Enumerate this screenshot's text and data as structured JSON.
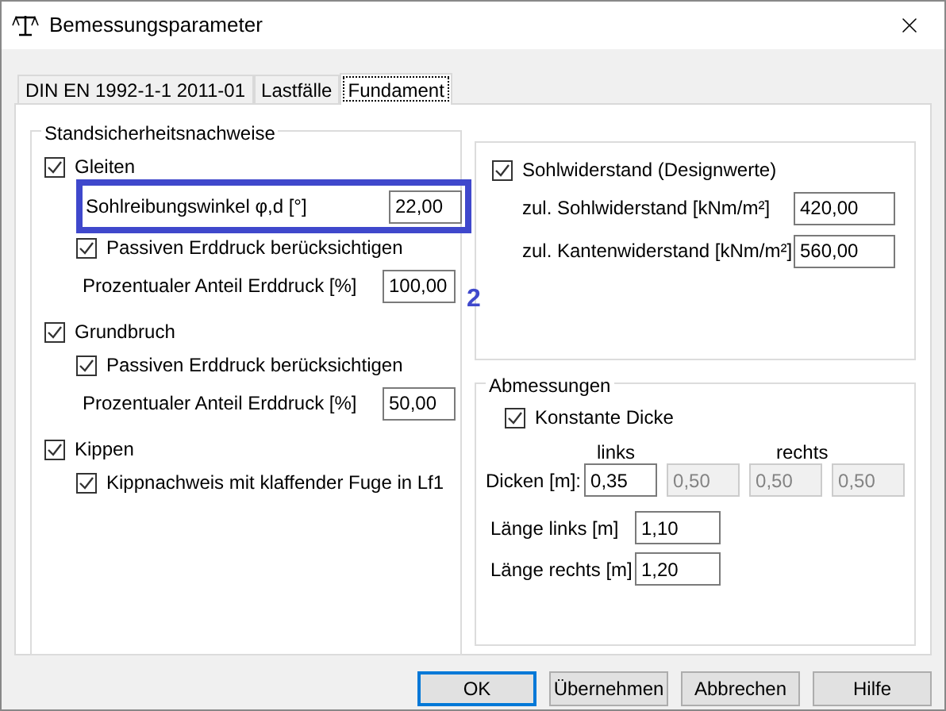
{
  "window": {
    "title": "Bemessungsparameter"
  },
  "tabs": [
    {
      "label": "DIN EN 1992-1-1 2011-01",
      "selected": false
    },
    {
      "label": "Lastfälle",
      "selected": false
    },
    {
      "label": "Fundament",
      "selected": true
    }
  ],
  "stability": {
    "title": "Standsicherheitsnachweise",
    "sections": [
      {
        "label": "Gleiten",
        "checked": true,
        "items": [
          {
            "kind": "field",
            "label": "Sohlreibungswinkel φ,d [°]",
            "value": "22,00",
            "highlighted": true
          },
          {
            "kind": "checkbox",
            "label": "Passiven Erddruck berücksichtigen",
            "checked": true
          },
          {
            "kind": "field",
            "label": "Prozentualer Anteil Erddruck [%]",
            "value": "100,00",
            "highlighted": false
          }
        ]
      },
      {
        "label": "Grundbruch",
        "checked": true,
        "items": [
          {
            "kind": "checkbox",
            "label": "Passiven Erddruck berücksichtigen",
            "checked": true
          },
          {
            "kind": "field",
            "label": "Prozentualer Anteil Erddruck [%]",
            "value": "50,00",
            "highlighted": false
          }
        ]
      },
      {
        "label": "Kippen",
        "checked": true,
        "items": [
          {
            "kind": "checkbox",
            "label": "Kippnachweis mit klaffender Fuge in Lf1",
            "checked": true
          }
        ]
      }
    ]
  },
  "annotation": {
    "label": "2"
  },
  "soil": {
    "label": "Sohlwiderstand (Designwerte)",
    "checked": true,
    "fields": [
      {
        "label": "zul. Sohlwiderstand [kNm/m²]",
        "value": "420,00"
      },
      {
        "label": "zul. Kantenwiderstand [kNm/m²]",
        "value": "560,00"
      }
    ]
  },
  "dimensions": {
    "title": "Abmessungen",
    "constant": {
      "label": "Konstante Dicke",
      "checked": true
    },
    "left_header": "links",
    "right_header": "rechts",
    "thickness_label": "Dicken [m]:",
    "thickness": [
      {
        "value": "0,35",
        "disabled": false
      },
      {
        "value": "0,50",
        "disabled": true
      },
      {
        "value": "0,50",
        "disabled": true
      },
      {
        "value": "0,50",
        "disabled": true
      }
    ],
    "lengths": [
      {
        "label": "Länge links [m]",
        "value": "1,10"
      },
      {
        "label": "Länge rechts [m]",
        "value": "1,20"
      }
    ]
  },
  "buttons": [
    {
      "label": "OK",
      "default": true
    },
    {
      "label": "Übernehmen",
      "default": false
    },
    {
      "label": "Abbrechen",
      "default": false
    },
    {
      "label": "Hilfe",
      "default": false
    }
  ]
}
